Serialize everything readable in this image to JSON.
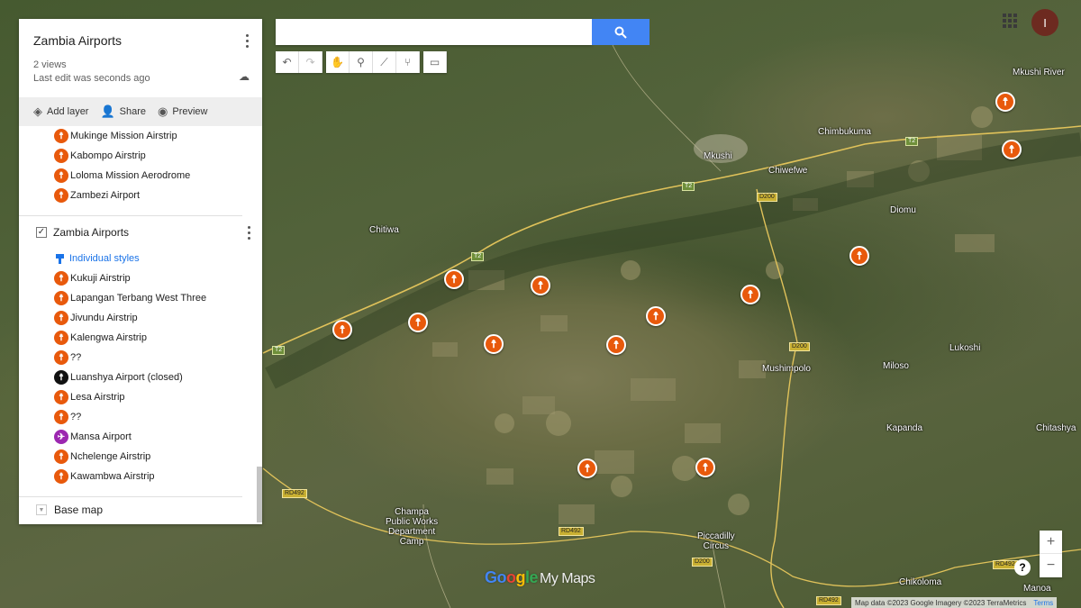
{
  "panel": {
    "title": "Zambia Airports",
    "views": "2 views",
    "last_edit": "Last edit was seconds ago",
    "toolbar": {
      "add_layer": "Add layer",
      "share": "Share",
      "preview": "Preview"
    },
    "upper_items": [
      {
        "label": "Mukinge Mission Airstrip",
        "icon_color": "#e8590c"
      },
      {
        "label": "Kabompo Airstrip",
        "icon_color": "#e8590c"
      },
      {
        "label": "Loloma Mission Aerodrome",
        "icon_color": "#e8590c"
      },
      {
        "label": "Zambezi Airport",
        "icon_color": "#e8590c"
      }
    ],
    "layer": {
      "name": "Zambia Airports",
      "checked": true,
      "styles_link": "Individual styles",
      "items": [
        {
          "label": "Kukuji Airstrip",
          "icon_color": "#e8590c"
        },
        {
          "label": "Lapangan Terbang West Three",
          "icon_color": "#e8590c"
        },
        {
          "label": "Jivundu Airstrip",
          "icon_color": "#e8590c"
        },
        {
          "label": "Kalengwa Airstrip",
          "icon_color": "#e8590c"
        },
        {
          "label": "??",
          "icon_color": "#e8590c"
        },
        {
          "label": "Luanshya Airport (closed)",
          "icon_color": "#111111"
        },
        {
          "label": "Lesa Airstrip",
          "icon_color": "#e8590c"
        },
        {
          "label": "??",
          "icon_color": "#e8590c"
        },
        {
          "label": "Mansa Airport",
          "icon_color": "#9c27b0"
        },
        {
          "label": "Nchelenge Airstrip",
          "icon_color": "#e8590c"
        },
        {
          "label": "Kawambwa Airstrip",
          "icon_color": "#e8590c"
        }
      ]
    },
    "base_map": "Base map"
  },
  "search": {
    "value": "",
    "placeholder": ""
  },
  "user": {
    "initial": "I"
  },
  "map": {
    "places": {
      "mkushi_river": "Mkushi River",
      "chimbukuma": "Chimbukuma",
      "mkushi": "Mkushi",
      "chiwefwe": "Chiwefwe",
      "diomu": "Diomu",
      "chitiwa": "Chitiwa",
      "lukoshi": "Lukoshi",
      "mushimpolo": "Mushimpolo",
      "miloso": "Miloso",
      "kapanda": "Kapanda",
      "chitashya": "Chitashya",
      "champa": "Champa\nPublic Works\nDepartment\nCamp",
      "piccadilly": "Piccadilly\nCircus",
      "chikoloma": "Chikoloma",
      "manoa": "Manoa"
    },
    "shields": {
      "t2_a": "T2",
      "t2_b": "T2",
      "t2_c": "T2",
      "t2_d": "T2",
      "d200_a": "D200",
      "d200_b": "D200",
      "d200_c": "D200",
      "rd492_a": "RD492",
      "rd492_b": "RD492",
      "rd492_c": "RD492",
      "rd492_d": "RD492"
    },
    "marker_color": "#e8590c",
    "marker_count": 14
  },
  "zoom": {
    "in": "+",
    "out": "−"
  },
  "help": "?",
  "logo": {
    "g1": "Go",
    "g2": "o",
    "g3": "g",
    "g4": "le",
    "suffix": "My Maps"
  },
  "attribution": {
    "text": "Map data ©2023 Google Imagery ©2023 TerraMetrics",
    "terms": "Terms"
  }
}
